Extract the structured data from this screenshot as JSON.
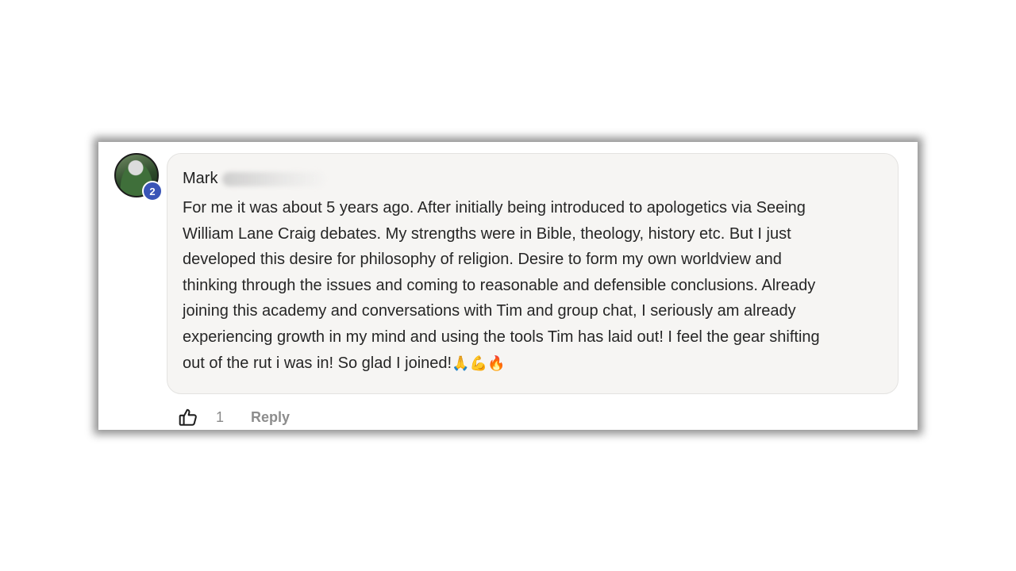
{
  "comment": {
    "author_first": "Mark",
    "level": "2",
    "text": "For me it was about 5 years ago. After initially being introduced to apologetics via Seeing\nWilliam Lane Craig debates. My strengths were in Bible, theology, history etc. But I just\ndeveloped this desire for philosophy of religion. Desire to form my own worldview and\nthinking through the issues and coming to reasonable and defensible conclusions. Already\njoining this academy and conversations with Tim and group chat, I seriously am already\nexperiencing growth in my mind and using the tools Tim has laid out! I feel the gear shifting\nout of the rut i was in! So glad I joined!",
    "emojis": [
      "🙏",
      "💪",
      "🔥"
    ],
    "like_count": "1",
    "reply_label": "Reply"
  },
  "icons": {
    "like": "thumbs-up-icon"
  },
  "colors": {
    "badge": "#3a55b7",
    "bubble_bg": "#f6f5f3",
    "action_text": "#8d8d8d"
  }
}
